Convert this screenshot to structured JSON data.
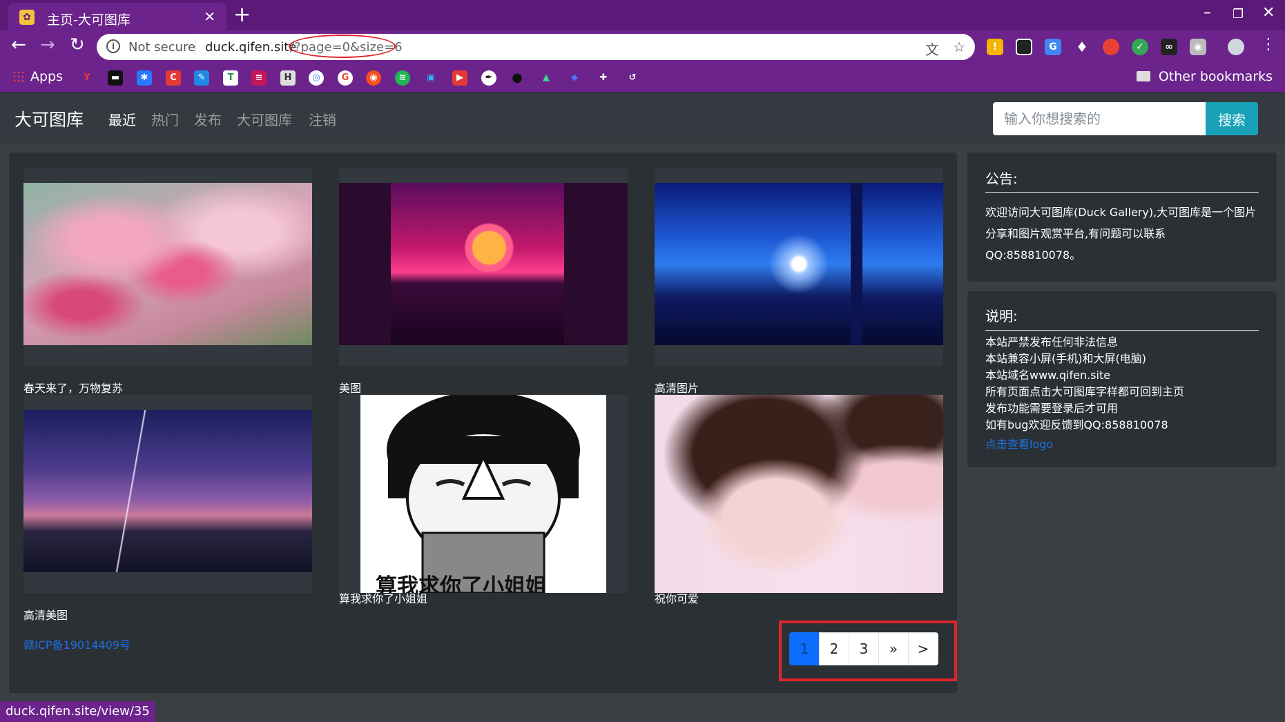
{
  "browser": {
    "tab_title": "主页-大可图库",
    "tab_favicon": "duck-favicon",
    "new_tab_label": "+",
    "address": {
      "security_label": "Not secure",
      "host": "duck.qifen.site",
      "path": "/?page=0&size=6"
    },
    "bookmarks": {
      "apps_label": "Apps",
      "other_label": "Other bookmarks"
    },
    "status_url": "duck.qifen.site/view/35"
  },
  "site": {
    "brand": "大可图库",
    "nav": [
      "最近",
      "热门",
      "发布",
      "大可图库",
      "注销"
    ],
    "active_nav_index": 0,
    "search": {
      "placeholder": "输入你想搜索的",
      "button": "搜索"
    },
    "gallery": [
      {
        "caption": "春天来了，万物复苏",
        "image": "pink-carnation-flowers"
      },
      {
        "caption": "美图",
        "image": "synthwave-sunset-highway"
      },
      {
        "caption": "高清图片",
        "image": "blue-lighthouse-night"
      },
      {
        "caption": "高清美图",
        "image": "anime-twilight-power-lines"
      },
      {
        "caption": "算我求你了小姐姐",
        "image": "panda-meme-begging"
      },
      {
        "caption": "祝你可爱",
        "image": "girl-portrait-pink"
      }
    ],
    "meme_text": "算我求你了小姐姐",
    "icp": "赣ICP备19014409号",
    "pagination": {
      "pages": [
        "1",
        "2",
        "3"
      ],
      "current": "1",
      "next_label": "»",
      "last_label": ">"
    },
    "notice": {
      "title": "公告:",
      "body": "欢迎访问大可图库(Duck Gallery),大可图库是一个图片分享和图片观赏平台,有问题可以联系QQ:858810078。"
    },
    "description": {
      "title": "说明:",
      "lines": [
        "本站严禁发布任何非法信息",
        "本站兼容小屏(手机)和大屏(电脑)",
        "本站域名www.qifen.site",
        "所有页面点击大可图库字样都可回到主页",
        "发布功能需要登录后才可用",
        "如有bug欢迎反馈到QQ:858810078"
      ],
      "link": "点击查看logo"
    }
  },
  "colors": {
    "browser_frame": "#6c238c",
    "navbar_bg": "#343a40",
    "page_bg": "#3a3f44",
    "card_bg": "#2b3035",
    "search_button": "#17a2b8",
    "page_active": "#0d6efd",
    "link": "#1e6fe0",
    "highlight": "#e0262c"
  }
}
